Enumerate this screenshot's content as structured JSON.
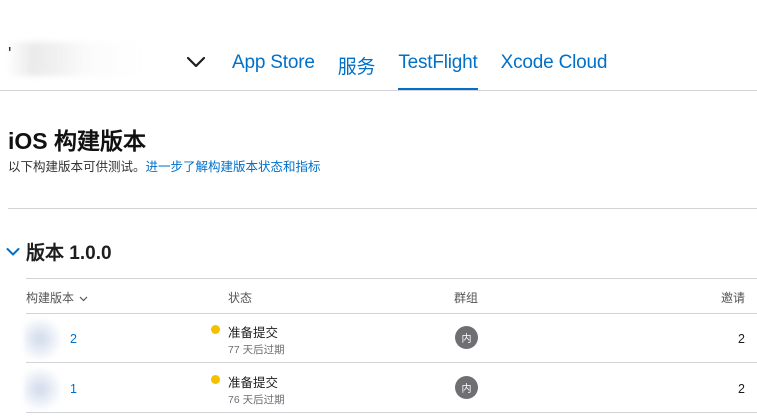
{
  "header": {
    "app_name_initial": "'",
    "nav": [
      {
        "label": "App Store",
        "active": false
      },
      {
        "label": "服务",
        "active": false
      },
      {
        "label": "TestFlight",
        "active": true
      },
      {
        "label": "Xcode Cloud",
        "active": false
      }
    ]
  },
  "page": {
    "title": "iOS 构建版本",
    "subtitle_text": "以下构建版本可供测试。",
    "subtitle_link": "进一步了解构建版本状态和指标"
  },
  "section": {
    "title": "版本 1.0.0"
  },
  "table": {
    "columns": {
      "build": "构建版本",
      "status": "状态",
      "groups": "群组",
      "invites": "邀请"
    },
    "rows": [
      {
        "build": "2",
        "status": "准备提交",
        "expires": "77 天后过期",
        "group_badge": "内",
        "invites": "2"
      },
      {
        "build": "1",
        "status": "准备提交",
        "expires": "76 天后过期",
        "group_badge": "内",
        "invites": "2"
      }
    ]
  },
  "colors": {
    "accent": "#0070c9",
    "status_yellow": "#f5c000",
    "badge_gray": "#6e6e73",
    "divider": "#d2d2d7"
  }
}
